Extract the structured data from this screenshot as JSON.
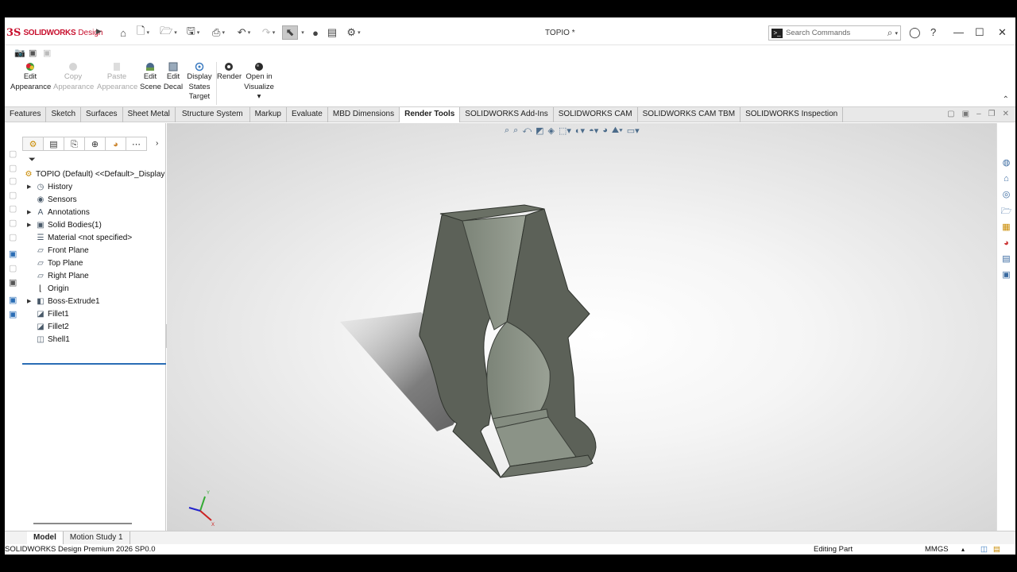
{
  "app": {
    "logo_ds": "3S",
    "logo_name": "SOLIDWORKS",
    "logo_edition": "Design",
    "document_title": "TOPIO *",
    "search_placeholder": "Search Commands"
  },
  "ribbon": {
    "buttons": [
      {
        "line1": "Edit",
        "line2": "Appearance",
        "icon": "appearance-icon",
        "enabled": true
      },
      {
        "line1": "Copy",
        "line2": "Appearance",
        "icon": "copy-appearance-icon",
        "enabled": false
      },
      {
        "line1": "Paste",
        "line2": "Appearance",
        "icon": "paste-appearance-icon",
        "enabled": false
      },
      {
        "line1": "Edit",
        "line2": "Scene",
        "icon": "scene-icon",
        "enabled": true
      },
      {
        "line1": "Edit",
        "line2": "Decal",
        "icon": "decal-icon",
        "enabled": true
      },
      {
        "line1": "Display",
        "line2": "States",
        "line3": "Target",
        "icon": "display-states-icon",
        "enabled": true
      },
      {
        "line1": "Render",
        "icon": "render-icon",
        "enabled": true
      },
      {
        "line1": "Open in",
        "line2": "Visualize",
        "line3": "▾",
        "icon": "visualize-icon",
        "enabled": true
      }
    ]
  },
  "tabs": [
    {
      "label": "Features"
    },
    {
      "label": "Sketch"
    },
    {
      "label": "Surfaces"
    },
    {
      "label": "Sheet Metal"
    },
    {
      "label": "Structure System"
    },
    {
      "label": "Markup"
    },
    {
      "label": "Evaluate"
    },
    {
      "label": "MBD Dimensions"
    },
    {
      "label": "Render Tools",
      "active": true
    },
    {
      "label": "SOLIDWORKS Add-Ins"
    },
    {
      "label": "SOLIDWORKS CAM"
    },
    {
      "label": "SOLIDWORKS CAM TBM"
    },
    {
      "label": "SOLIDWORKS Inspection"
    }
  ],
  "tree": {
    "root": "TOPIO (Default) <<Default>_Display",
    "items": [
      {
        "label": "History",
        "expandable": true,
        "icon": "history-icon"
      },
      {
        "label": "Sensors",
        "expandable": false,
        "icon": "sensors-icon"
      },
      {
        "label": "Annotations",
        "expandable": true,
        "icon": "annotations-icon"
      },
      {
        "label": "Solid Bodies(1)",
        "expandable": true,
        "icon": "solid-bodies-icon"
      },
      {
        "label": "Material <not specified>",
        "expandable": false,
        "icon": "material-icon"
      },
      {
        "label": "Front Plane",
        "expandable": false,
        "icon": "plane-icon"
      },
      {
        "label": "Top Plane",
        "expandable": false,
        "icon": "plane-icon"
      },
      {
        "label": "Right Plane",
        "expandable": false,
        "icon": "plane-icon"
      },
      {
        "label": "Origin",
        "expandable": false,
        "icon": "origin-icon"
      },
      {
        "label": "Boss-Extrude1",
        "expandable": true,
        "icon": "extrude-icon"
      },
      {
        "label": "Fillet1",
        "expandable": false,
        "icon": "fillet-icon"
      },
      {
        "label": "Fillet2",
        "expandable": false,
        "icon": "fillet-icon"
      },
      {
        "label": "Shell1",
        "expandable": false,
        "icon": "shell-icon"
      }
    ]
  },
  "bottom_tabs": [
    {
      "label": "Model",
      "active": true
    },
    {
      "label": "Motion Study 1"
    }
  ],
  "status": {
    "product": "SOLIDWORKS Design Premium 2026 SP0.0",
    "mode": "Editing Part",
    "units": "MMGS",
    "units_arrow": "▴"
  },
  "colors": {
    "brand": "#c8102e",
    "part_face": "#5c6158",
    "part_inner": "#8c9486",
    "rollback_bar": "#2a6db5"
  }
}
